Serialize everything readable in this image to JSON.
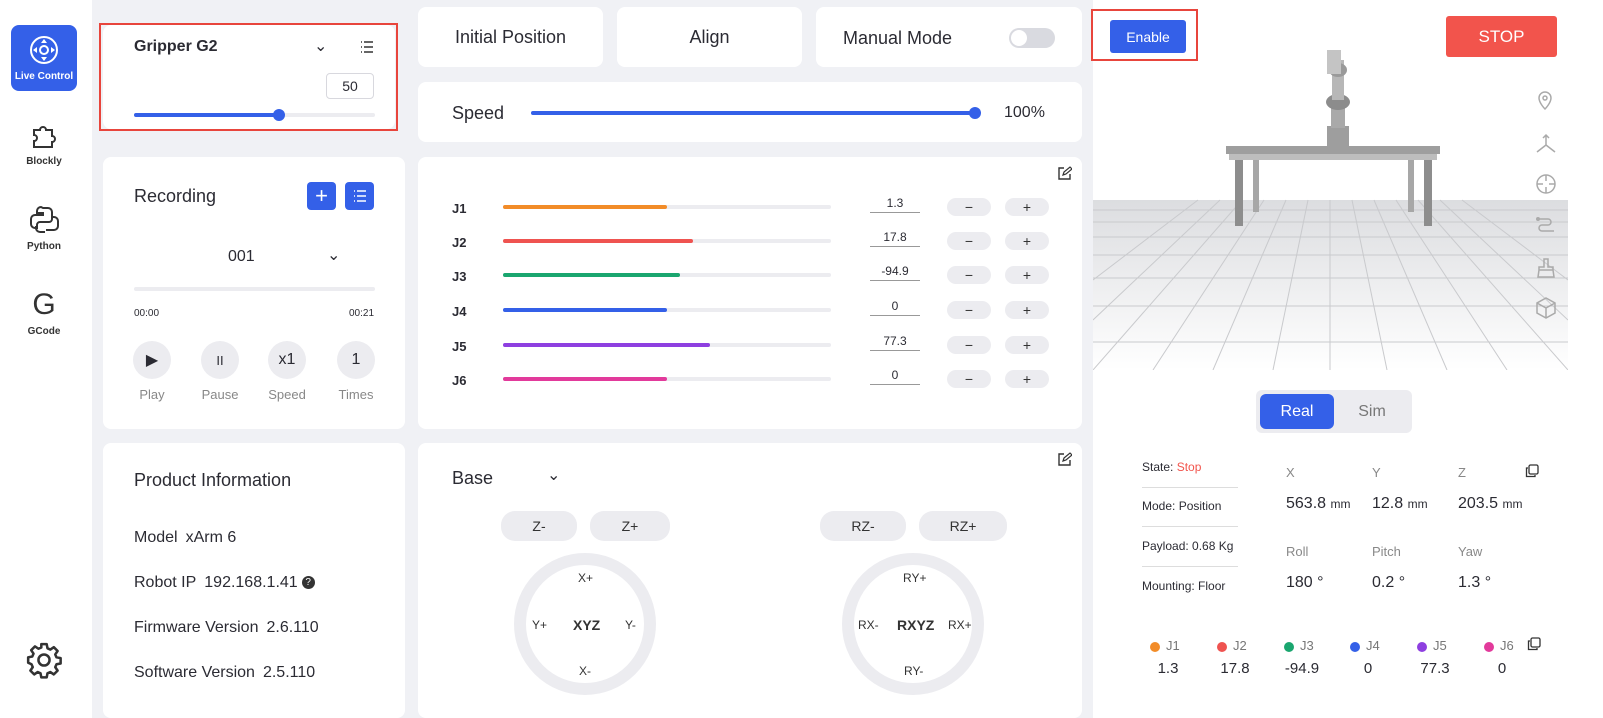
{
  "sidebar": {
    "items": [
      {
        "label": "Live Control",
        "icon": "live-control-icon"
      },
      {
        "label": "Blockly",
        "icon": "puzzle-icon"
      },
      {
        "label": "Python",
        "icon": "python-icon"
      },
      {
        "label": "GCode",
        "icon": "gcode-icon"
      }
    ],
    "settings_icon": "gear-icon"
  },
  "gripper": {
    "name": "Gripper G2",
    "value": "50",
    "level_percent": 60
  },
  "recording": {
    "title": "Recording",
    "selected": "001",
    "time_start": "00:00",
    "time_end": "00:21",
    "controls": [
      {
        "symbol": "▶",
        "label": "Play"
      },
      {
        "symbol": "II",
        "label": "Pause"
      },
      {
        "symbol": "x1",
        "label": "Speed"
      },
      {
        "symbol": "1",
        "label": "Times"
      }
    ]
  },
  "product": {
    "title": "Product Information",
    "model_label": "Model",
    "model": "xArm 6",
    "ip_label": "Robot IP",
    "ip": "192.168.1.41",
    "firmware_label": "Firmware Version",
    "firmware": "2.6.110",
    "software_label": "Software Version",
    "software": "2.5.110"
  },
  "top_buttons": {
    "initial": "Initial Position",
    "align": "Align",
    "manual": "Manual Mode"
  },
  "speed": {
    "label": "Speed",
    "value": "100%",
    "level_percent": 100
  },
  "joints": [
    {
      "name": "J1",
      "value": "1.3",
      "color": "#f28c28",
      "level_percent": 50
    },
    {
      "name": "J2",
      "value": "17.8",
      "color": "#ef5350",
      "level_percent": 58
    },
    {
      "name": "J3",
      "value": "-94.9",
      "color": "#1aa66f",
      "level_percent": 54
    },
    {
      "name": "J4",
      "value": "0",
      "color": "#3460e8",
      "level_percent": 50
    },
    {
      "name": "J5",
      "value": "77.3",
      "color": "#8e3fe0",
      "level_percent": 63
    },
    {
      "name": "J6",
      "value": "0",
      "color": "#e23a9b",
      "level_percent": 50
    }
  ],
  "jog": {
    "frame": "Base",
    "linear": {
      "minus": "Z-",
      "plus": "Z+",
      "top": "X+",
      "bottom": "X-",
      "left": "Y+",
      "right": "Y-",
      "center": "XYZ"
    },
    "rotary": {
      "minus": "RZ-",
      "plus": "RZ+",
      "top": "RY+",
      "bottom": "RY-",
      "left": "RX-",
      "right": "RX+",
      "center": "RXYZ"
    }
  },
  "viewer": {
    "enable": "Enable",
    "stop": "STOP",
    "real": "Real",
    "sim": "Sim",
    "side_icons": [
      "location-icon",
      "axes-icon",
      "crosshair-icon",
      "path-icon",
      "brush-icon",
      "cube-icon"
    ]
  },
  "status": {
    "state_label": "State:",
    "state": "Stop",
    "mode_label": "Mode:",
    "mode": "Position",
    "payload_label": "Payload:",
    "payload": "0.68 Kg",
    "mounting_label": "Mounting:",
    "mounting": "Floor"
  },
  "coords": {
    "x_label": "X",
    "x": "563.8",
    "y_label": "Y",
    "y": "12.8",
    "z_label": "Z",
    "z": "203.5",
    "unit": "mm",
    "roll_label": "Roll",
    "roll": "180 °",
    "pitch_label": "Pitch",
    "pitch": "0.2 °",
    "yaw_label": "Yaw",
    "yaw": "1.3 °"
  },
  "colors": {
    "accent": "#3460e8",
    "stop": "#f2544c",
    "highlight": "#e8453c"
  }
}
